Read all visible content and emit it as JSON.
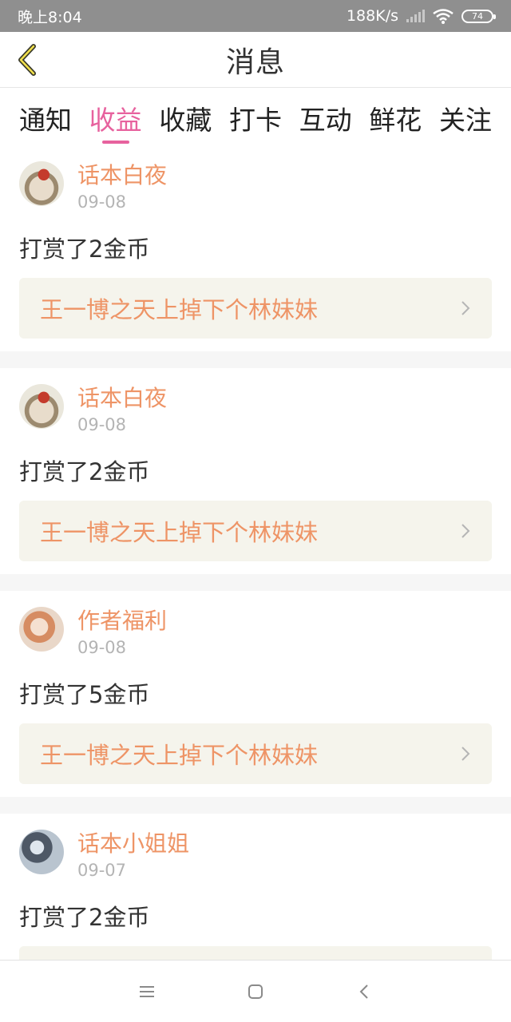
{
  "status_bar": {
    "time": "晚上8:04",
    "network_speed": "188K/s",
    "battery_level": "74",
    "icons": [
      "signal-icon",
      "wifi-icon",
      "battery-icon"
    ]
  },
  "header": {
    "title": "消息",
    "back_icon": "chevron-left-icon"
  },
  "tabs": [
    {
      "label": "通知",
      "active": false
    },
    {
      "label": "收益",
      "active": true
    },
    {
      "label": "收藏",
      "active": false
    },
    {
      "label": "打卡",
      "active": false
    },
    {
      "label": "互动",
      "active": false
    },
    {
      "label": "鲜花",
      "active": false
    },
    {
      "label": "关注",
      "active": false
    }
  ],
  "messages": [
    {
      "username": "话本白夜",
      "date": "09-08",
      "text": "打赏了2金币",
      "book_title": "王一博之天上掉下个林妹妹"
    },
    {
      "username": "话本白夜",
      "date": "09-08",
      "text": "打赏了2金币",
      "book_title": "王一博之天上掉下个林妹妹"
    },
    {
      "username": "作者福利",
      "date": "09-08",
      "text": "打赏了5金币",
      "book_title": "王一博之天上掉下个林妹妹"
    },
    {
      "username": "话本小姐姐",
      "date": "09-07",
      "text": "打赏了2金币",
      "book_title": ""
    }
  ],
  "colors": {
    "accent": "#e7629e",
    "username": "#ee9466",
    "link_background": "#f5f4ec",
    "status_bar": "#8f8f8f"
  },
  "nav_bar": {
    "icons": [
      "menu-icon",
      "home-icon",
      "back-icon"
    ]
  }
}
